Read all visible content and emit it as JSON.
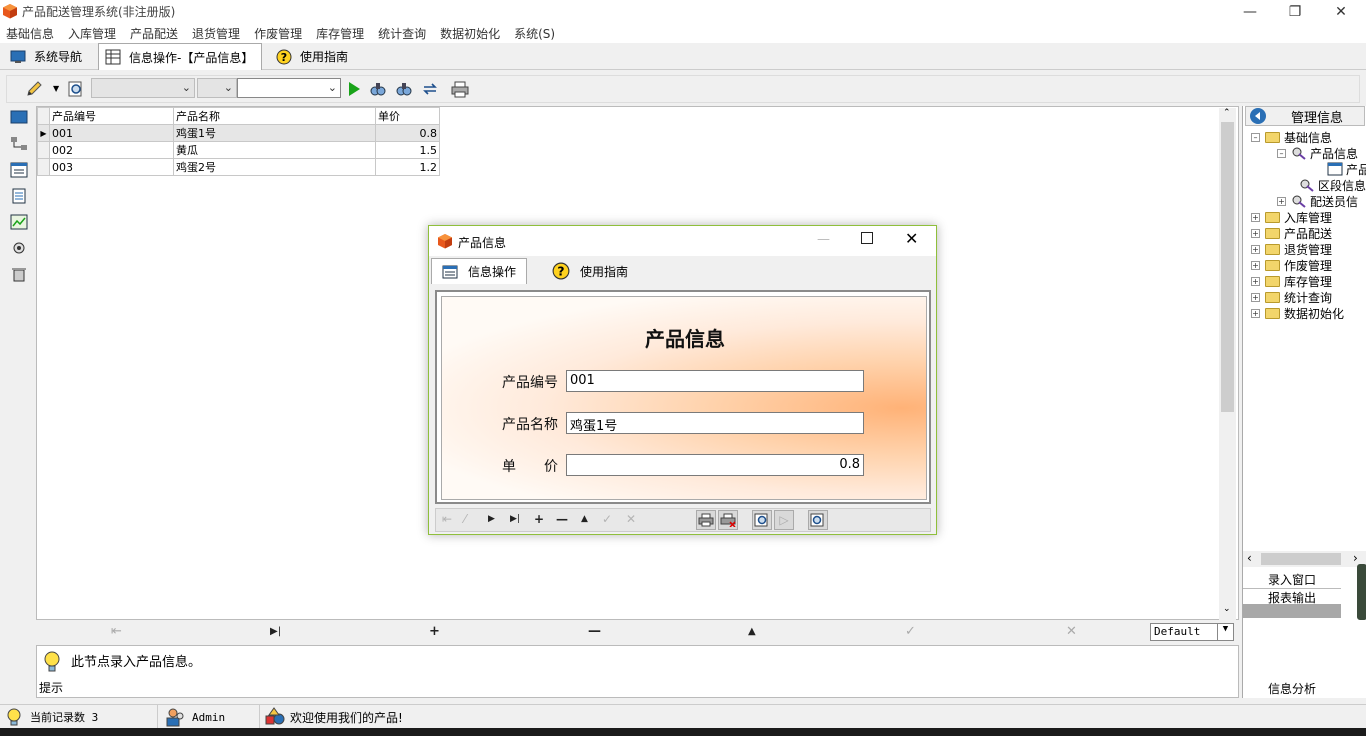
{
  "window": {
    "title": "产品配送管理系统(非注册版)"
  },
  "menu": [
    "基础信息",
    "入库管理",
    "产品配送",
    "退货管理",
    "作废管理",
    "库存管理",
    "统计查询",
    "数据初始化",
    "系统(S)"
  ],
  "tabs": {
    "nav": "系统导航",
    "info": "信息操作-【产品信息】",
    "guide": "使用指南"
  },
  "grid": {
    "columns": [
      "产品编号",
      "产品名称",
      "单价"
    ],
    "rows": [
      {
        "id": "001",
        "name": "鸡蛋1号",
        "price": "0.8"
      },
      {
        "id": "002",
        "name": "黄瓜",
        "price": "1.5"
      },
      {
        "id": "003",
        "name": "鸡蛋2号",
        "price": "1.2"
      }
    ]
  },
  "navbar": {
    "default_value": "Default"
  },
  "hint": {
    "text": "此节点录入产品信息。",
    "label": "提示"
  },
  "right_panel": {
    "header": "管理信息",
    "tree": {
      "basic": "基础信息",
      "product": "产品信息",
      "product_child": "产品",
      "segment": "区段信息",
      "courier": "配送员信",
      "folders": [
        "入库管理",
        "产品配送",
        "退货管理",
        "作废管理",
        "库存管理",
        "统计查询",
        "数据初始化"
      ]
    },
    "buttons": {
      "entry": "录入窗口",
      "report": "报表输出",
      "analysis": "信息分析"
    }
  },
  "status": {
    "record_count": "当前记录数 3",
    "user": "Admin",
    "welcome": "欢迎使用我们的产品!"
  },
  "dialog": {
    "title": "产品信息",
    "tab_info": "信息操作",
    "tab_guide": "使用指南",
    "form_title": "产品信息",
    "label_id": "产品编号",
    "label_name": "产品名称",
    "label_price": "单　　价",
    "value_id": "001",
    "value_name": "鸡蛋1号",
    "value_price": "0.8"
  },
  "colors": {
    "accent_border": "#8fbf3b",
    "form_gradient": "#ffb277"
  }
}
